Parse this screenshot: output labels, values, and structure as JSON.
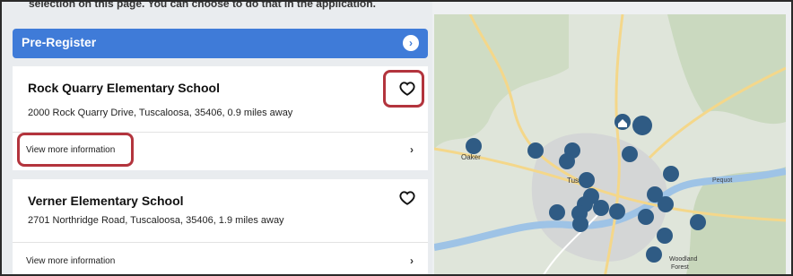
{
  "top_text": "selection on this page. You can choose to do that in the application.",
  "prereg": {
    "label": "Pre-Register",
    "arrow_icon": "arrow-circle-right-icon"
  },
  "schools": [
    {
      "name": "Rock Quarry Elementary School",
      "address": "2000 Rock Quarry Drive, Tuscaloosa, 35406, 0.9 miles away",
      "more_label": "View more information"
    },
    {
      "name": "Verner Elementary School",
      "address": "2701 Northridge Road, Tuscaloosa, 35406, 1.9 miles away",
      "more_label": "View more information"
    }
  ],
  "map": {
    "labels": {
      "oaker": "Oaker",
      "woodland": "Woodland\nForest",
      "pequot": "Pequot",
      "city_hint": "Tus"
    }
  },
  "colors": {
    "accent": "#3f7bd8",
    "highlight": "#b3343d",
    "marker": "#2f5b84",
    "map_bg": "#dfe5da"
  }
}
